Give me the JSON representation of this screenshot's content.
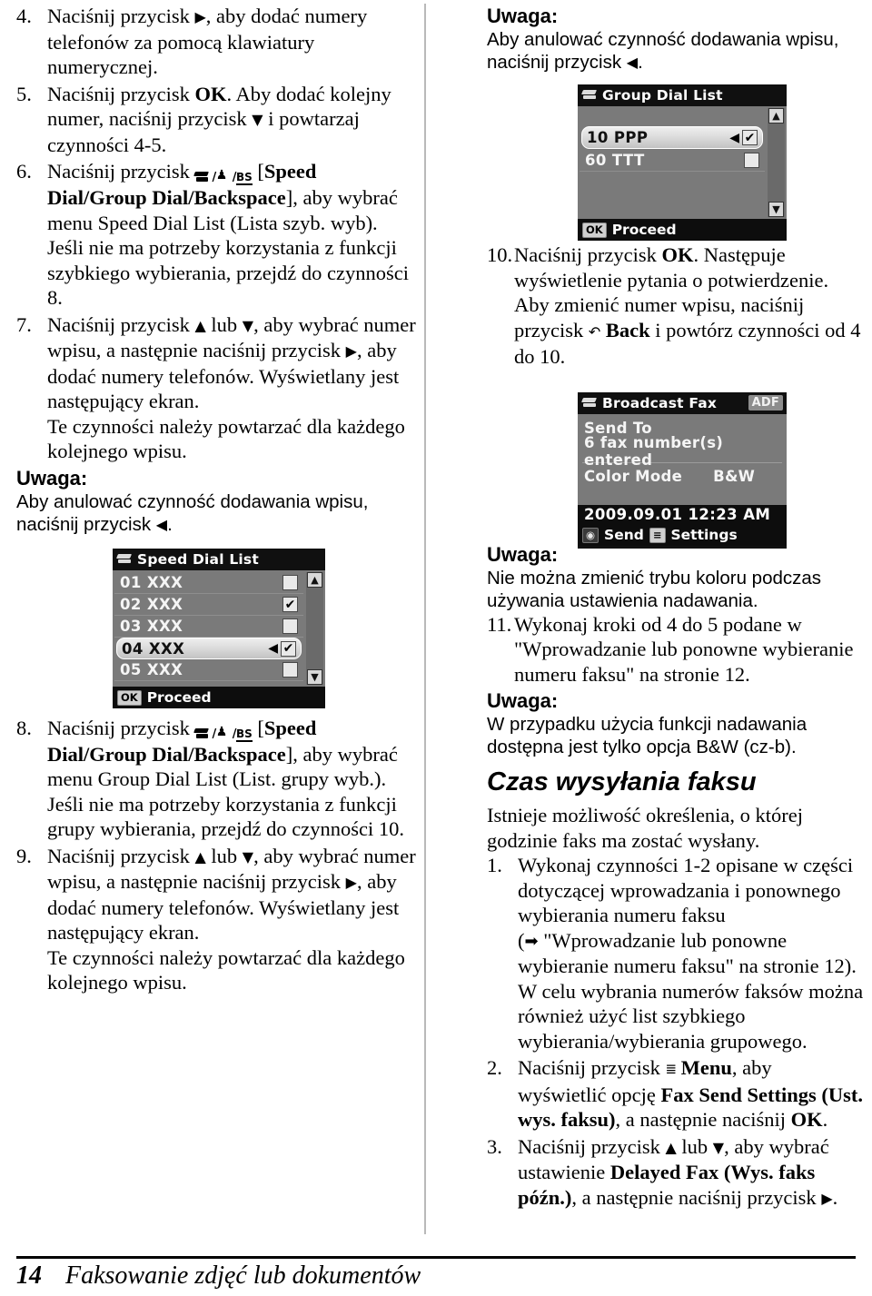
{
  "left_column": {
    "items": [
      {
        "num": "4.",
        "segments": [
          {
            "t": "Naciśnij przycisk "
          },
          {
            "icon": "arrow-right"
          },
          {
            "t": ", aby dodać numery telefonów za pomocą klawiatury numerycznej."
          }
        ]
      },
      {
        "num": "5.",
        "segments": [
          {
            "t": "Naciśnij przycisk "
          },
          {
            "t": "OK",
            "b": true
          },
          {
            "t": ". Aby dodać kolejny numer, naciśnij przycisk "
          },
          {
            "icon": "arrow-down"
          },
          {
            "t": " i powtarzaj czynności 4-5."
          }
        ]
      },
      {
        "num": "6.",
        "segments": [
          {
            "t": "Naciśnij przycisk "
          },
          {
            "icon": "speed-dial-group-backspace"
          },
          {
            "t": " ["
          },
          {
            "t": "Speed Dial/Group Dial/Backspace",
            "b": true
          },
          {
            "t": "], aby wybrać menu Speed Dial List (Lista szyb. wyb). Jeśli nie ma potrzeby korzystania z funkcji szybkiego wybierania, przejdź do czynności 8."
          }
        ]
      },
      {
        "num": "7.",
        "segments": [
          {
            "t": "Naciśnij przycisk "
          },
          {
            "icon": "arrow-up"
          },
          {
            "t": " lub "
          },
          {
            "icon": "arrow-down"
          },
          {
            "t": ", aby wybrać numer wpisu, a następnie naciśnij przycisk "
          },
          {
            "icon": "arrow-right"
          },
          {
            "t": ", aby dodać numery telefonów. Wyświetlany jest następujący ekran."
          },
          {
            "br": true
          },
          {
            "t": "Te czynności należy powtarzać dla każdego kolejnego wpisu."
          }
        ]
      }
    ],
    "note_1": {
      "title": "Uwaga:",
      "segments": [
        {
          "t": "Aby anulować czynność dodawania wpisu, naciśnij przycisk "
        },
        {
          "icon": "arrow-left"
        },
        {
          "t": "."
        }
      ]
    },
    "items_2": [
      {
        "num": "8.",
        "segments": [
          {
            "t": "Naciśnij przycisk "
          },
          {
            "icon": "speed-dial-group-backspace"
          },
          {
            "t": " ["
          },
          {
            "t": "Speed Dial/Group Dial/Backspace",
            "b": true
          },
          {
            "t": "], aby wybrać menu Group Dial List (List. grupy wyb.). Jeśli nie ma potrzeby korzystania z funkcji grupy wybierania, przejdź do czynności 10."
          }
        ]
      },
      {
        "num": "9.",
        "segments": [
          {
            "t": "Naciśnij przycisk "
          },
          {
            "icon": "arrow-up"
          },
          {
            "t": " lub "
          },
          {
            "icon": "arrow-down"
          },
          {
            "t": ", aby wybrać numer wpisu, a następnie naciśnij przycisk "
          },
          {
            "icon": "arrow-right"
          },
          {
            "t": ", aby dodać numery telefonów. Wyświetlany jest następujący ekran."
          },
          {
            "br": true
          },
          {
            "t": "Te czynności należy powtarzać dla każdego kolejnego wpisu."
          }
        ]
      }
    ]
  },
  "right_column": {
    "note_1": {
      "title": "Uwaga:",
      "segments": [
        {
          "t": "Aby anulować czynność dodawania wpisu, naciśnij przycisk "
        },
        {
          "icon": "arrow-left"
        },
        {
          "t": "."
        }
      ]
    },
    "item_10": {
      "num": "10.",
      "segments": [
        {
          "t": "Naciśnij przycisk "
        },
        {
          "t": "OK",
          "b": true
        },
        {
          "t": ". Następuje wyświetlenie pytania o potwierdzenie. Aby zmienić numer wpisu, naciśnij przycisk "
        },
        {
          "icon": "back"
        },
        {
          "t": " "
        },
        {
          "t": "Back",
          "b": true
        },
        {
          "t": " i powtórz czynności od 4 do 10."
        }
      ]
    },
    "note_2": {
      "title": "Uwaga:",
      "segments": [
        {
          "t": "Nie można zmienić trybu koloru podczas używania ustawienia nadawania."
        }
      ]
    },
    "item_11": {
      "num": "11.",
      "segments": [
        {
          "t": "Wykonaj kroki od 4 do 5 podane w \"Wprowadzanie lub ponowne wybieranie numeru faksu\" na stronie 12."
        }
      ]
    },
    "note_3": {
      "title": "Uwaga:",
      "segments": [
        {
          "t": "W przypadku użycia funkcji nadawania dostępna jest tylko opcja B&W (cz-b)."
        }
      ]
    },
    "section_heading": "Czas wysyłania faksu",
    "intro": "Istnieje możliwość określenia, o której godzinie faks ma zostać wysłany.",
    "items": [
      {
        "num": "1.",
        "segments": [
          {
            "t": "Wykonaj czynności 1-2 opisane w części dotyczącej wprowadzania i ponownego wybierania numeru faksu"
          },
          {
            "br": true
          },
          {
            "t": "("
          },
          {
            "icon": "pointer-right"
          },
          {
            "t": " \"Wprowadzanie lub ponowne wybieranie numeru faksu\" na stronie 12). W celu wybrania numerów faksów można również użyć list szybkiego wybierania/wybierania grupowego."
          }
        ]
      },
      {
        "num": "2.",
        "segments": [
          {
            "t": "Naciśnij przycisk "
          },
          {
            "icon": "menu"
          },
          {
            "t": " "
          },
          {
            "t": "Menu",
            "b": true
          },
          {
            "t": ", aby wyświetlić opcję "
          },
          {
            "t": "Fax Send Settings (Ust. wys. faksu)",
            "b": true
          },
          {
            "t": ", a następnie naciśnij "
          },
          {
            "t": "OK",
            "b": true
          },
          {
            "t": "."
          }
        ]
      },
      {
        "num": "3.",
        "segments": [
          {
            "t": "Naciśnij przycisk "
          },
          {
            "icon": "arrow-up"
          },
          {
            "t": " lub "
          },
          {
            "icon": "arrow-down"
          },
          {
            "t": ", aby wybrać ustawienie "
          },
          {
            "t": "Delayed Fax (Wys. faks późn.)",
            "b": true
          },
          {
            "t": ", a następnie naciśnij przycisk "
          },
          {
            "icon": "arrow-right"
          },
          {
            "t": "."
          }
        ]
      }
    ]
  },
  "lcd_speed_dial": {
    "title": "Speed Dial List",
    "title_icon": "phone-icon",
    "rows": [
      {
        "label": "01 XXX",
        "checked": false,
        "selected": false
      },
      {
        "label": "02 XXX",
        "checked": true,
        "selected": false
      },
      {
        "label": "03 XXX",
        "checked": false,
        "selected": false
      },
      {
        "label": "04 XXX",
        "checked": true,
        "selected": true
      },
      {
        "label": "05 XXX",
        "checked": false,
        "selected": false
      }
    ],
    "scroll_up": "▲",
    "scroll_down": "▼",
    "footer_key": "OK",
    "footer_label": "Proceed"
  },
  "lcd_group_dial": {
    "title": "Group Dial List",
    "title_icon": "phone-icon",
    "rows": [
      {
        "label": "10 PPP",
        "checked": true,
        "selected": true
      },
      {
        "label": "60 TTT",
        "checked": false,
        "selected": false
      }
    ],
    "scroll_up": "▲",
    "scroll_down": "▼",
    "footer_key": "OK",
    "footer_label": "Proceed"
  },
  "lcd_broadcast_fax": {
    "title": "Broadcast Fax",
    "title_icon": "phone-icon",
    "badge": "ADF",
    "send_to_label": "Send To",
    "send_to_value": "6 fax number(s) entered",
    "color_mode_label": "Color Mode",
    "color_mode_value": "B&W",
    "datetime": "2009.09.01  12:23 AM",
    "footer_send_key": "◉",
    "footer_send_label": "Send",
    "footer_settings_key": "≡",
    "footer_settings_label": "Settings"
  },
  "footer": {
    "page_number": "14",
    "title": "Faksowanie zdjęć lub dokumentów"
  },
  "colors": {
    "lcd_bg": "#111111",
    "lcd_body": "#7a7a7a",
    "lcd_selected": "#e2e2e2",
    "divider": "#b9b9b9",
    "text": "#000000"
  }
}
